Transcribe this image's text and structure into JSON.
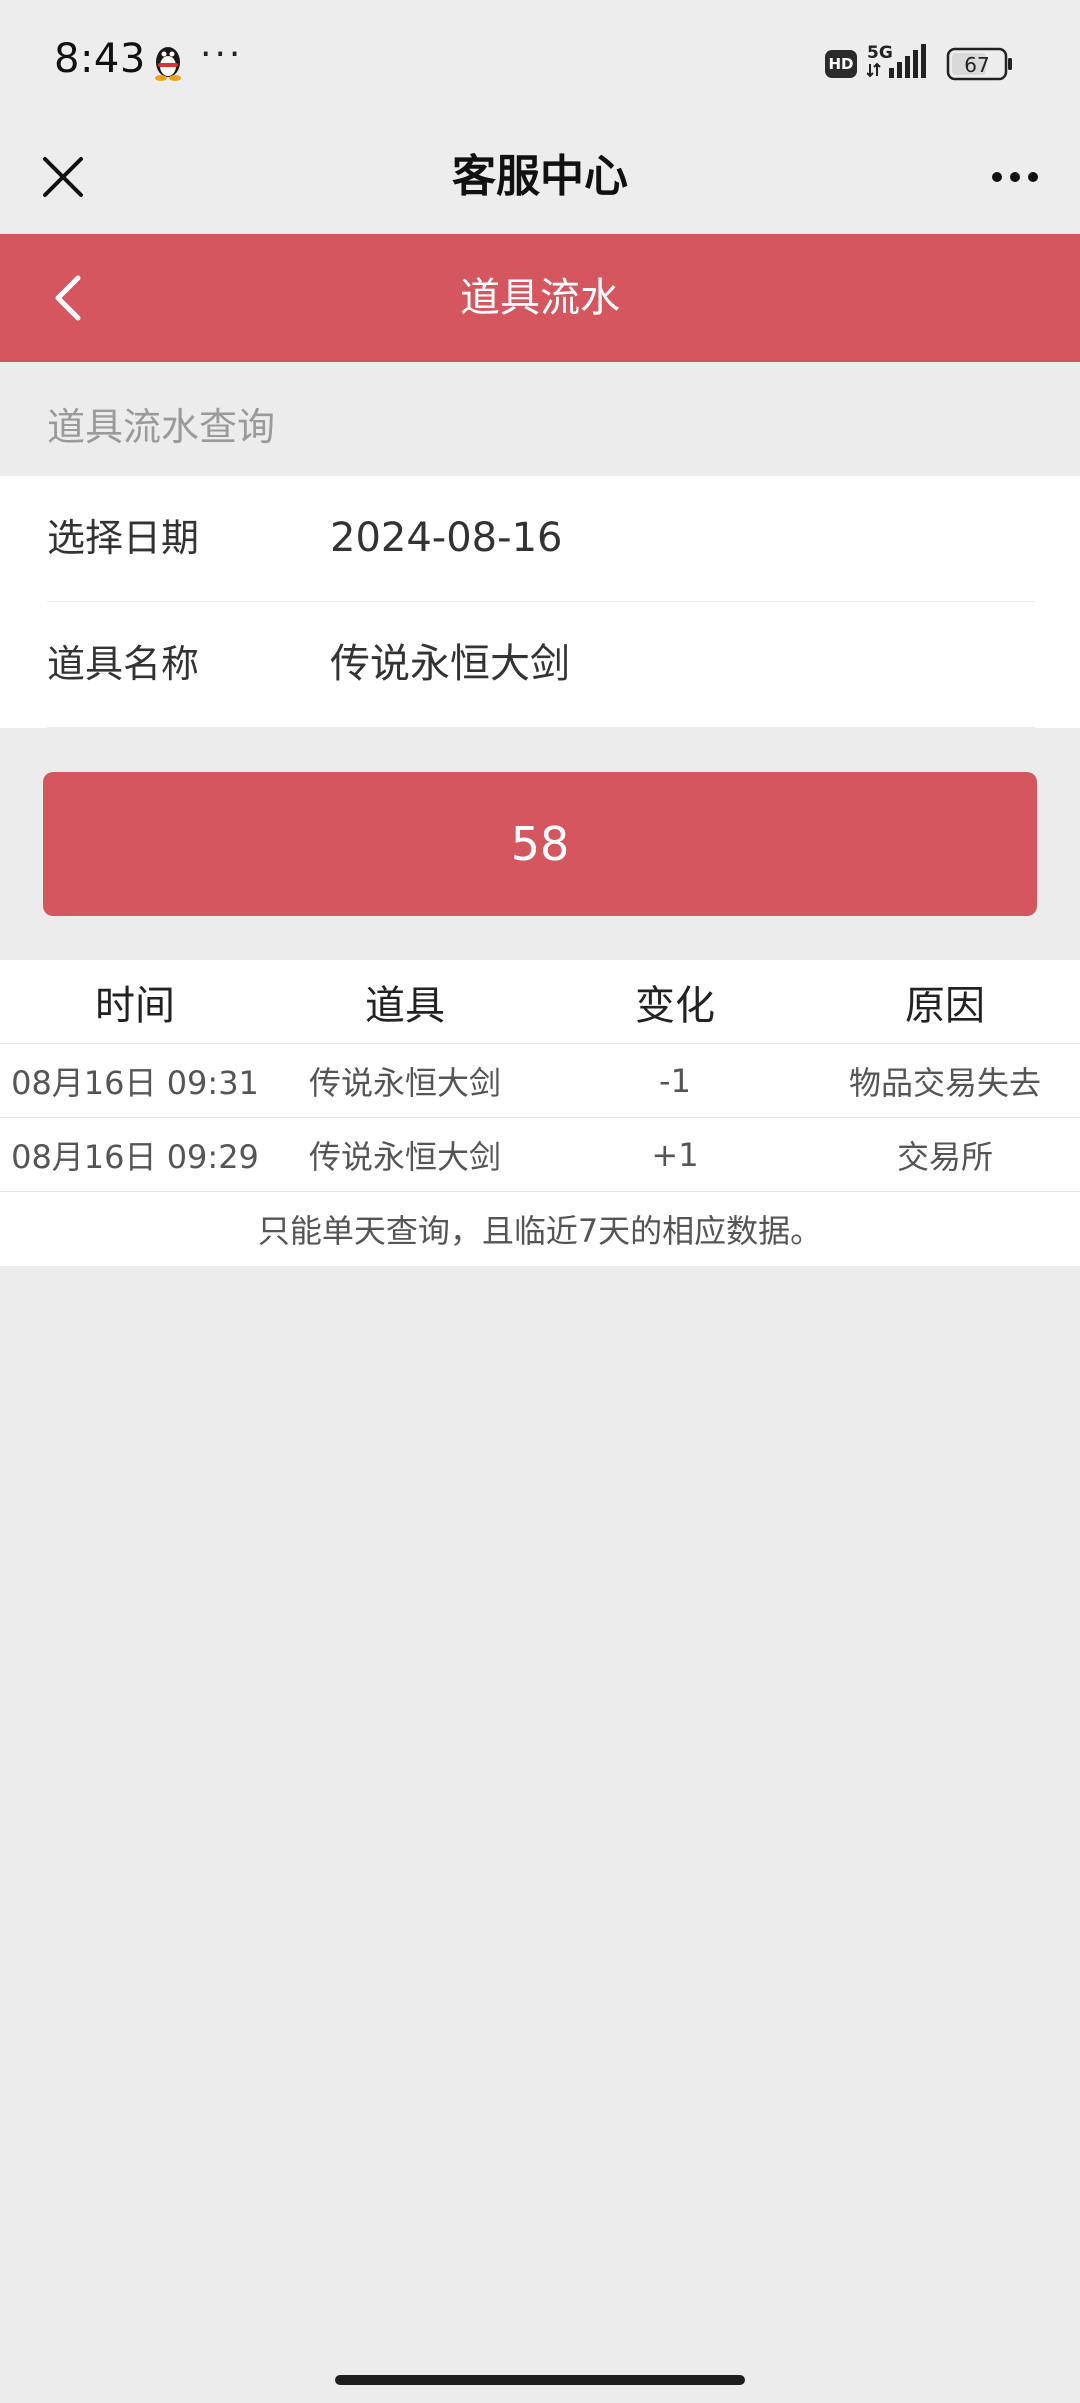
{
  "status_bar": {
    "time": "8:43",
    "dots": "···",
    "hd": "HD",
    "network": "5G",
    "battery": "67"
  },
  "title_bar": {
    "title": "客服中心"
  },
  "header": {
    "title": "道具流水"
  },
  "section": {
    "label": "道具流水查询"
  },
  "form": {
    "date_label": "选择日期",
    "date_value": "2024-08-16",
    "item_label": "道具名称",
    "item_value": "传说永恒大剑"
  },
  "query_button": {
    "label": "58"
  },
  "table": {
    "columns": [
      "时间",
      "道具",
      "变化",
      "原因"
    ],
    "rows": [
      [
        "08月16日 09:31",
        "传说永恒大剑",
        "-1",
        "物品交易失去"
      ],
      [
        "08月16日 09:29",
        "传说永恒大剑",
        "+1",
        "交易所"
      ]
    ],
    "note": "只能单天查询，且临近7天的相应数据。"
  },
  "colors": {
    "accent": "#d45760",
    "background": "#ececec"
  }
}
